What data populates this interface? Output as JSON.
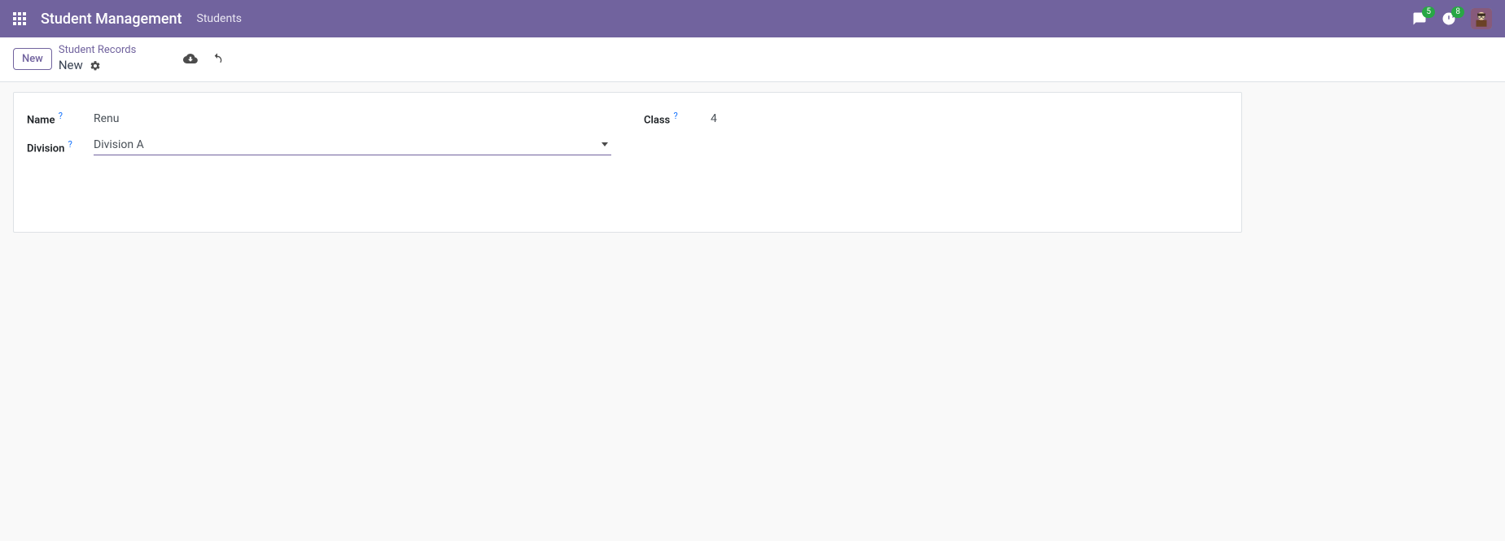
{
  "navbar": {
    "app_title": "Student Management",
    "menu": [
      {
        "label": "Students"
      }
    ],
    "messages_badge": "5",
    "activities_badge": "8"
  },
  "control_panel": {
    "new_button_label": "New",
    "breadcrumb_parent": "Student Records",
    "breadcrumb_current": "New"
  },
  "form": {
    "name": {
      "label": "Name",
      "help": "?",
      "value": "Renu"
    },
    "class": {
      "label": "Class",
      "help": "?",
      "value": "4"
    },
    "division": {
      "label": "Division",
      "help": "?",
      "value": "Division A"
    }
  }
}
